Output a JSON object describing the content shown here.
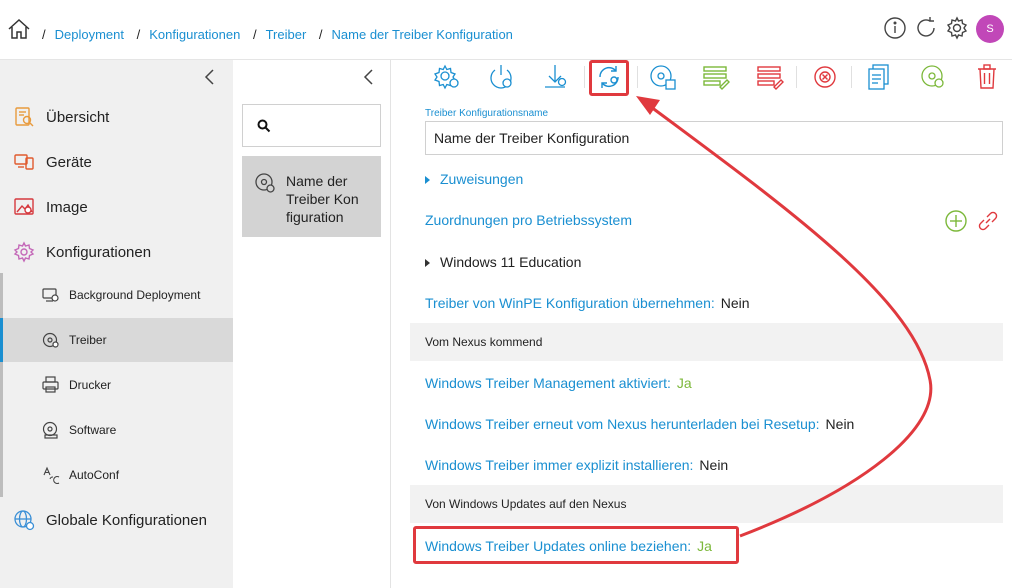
{
  "breadcrumb": {
    "sep": "/",
    "items": [
      "Deployment",
      "Konfigurationen",
      "Treiber",
      "Name der Treiber Konfiguration"
    ]
  },
  "user": {
    "initial": "S"
  },
  "sidebar": {
    "items": [
      {
        "label": "Übersicht",
        "icon": "overview-icon"
      },
      {
        "label": "Geräte",
        "icon": "devices-icon"
      },
      {
        "label": "Image",
        "icon": "image-icon"
      },
      {
        "label": "Konfigurationen",
        "icon": "configurations-icon"
      }
    ],
    "sub_items": [
      {
        "label": "Background Deployment",
        "icon": "background-deployment-icon"
      },
      {
        "label": "Treiber",
        "icon": "driver-icon",
        "active": true
      },
      {
        "label": "Drucker",
        "icon": "printer-icon"
      },
      {
        "label": "Software",
        "icon": "software-icon"
      },
      {
        "label": "AutoConf",
        "icon": "autoconf-icon"
      }
    ],
    "bottom_item": {
      "label": "Globale Konfigurationen",
      "icon": "globe-icon"
    }
  },
  "list": {
    "search_value": "",
    "card_lines": [
      "Name der",
      "Treiber Kon",
      "figuration"
    ]
  },
  "form": {
    "name_label": "Treiber Konfigurationsname",
    "name_value": "Name der Treiber Konfiguration",
    "zuweisungen": "Zuweisungen",
    "zuordnungen": "Zuordnungen pro Betriebssystem",
    "os_item": "Windows 11 Education",
    "winpe_key": "Treiber von WinPE Konfiguration übernehmen:",
    "winpe_val": "Nein",
    "section_nexus": "Vom Nexus kommend",
    "mgmt_key": "Windows Treiber Management aktiviert:",
    "mgmt_val": "Ja",
    "redownload_key": "Windows Treiber erneut vom Nexus herunterladen bei Resetup:",
    "redownload_val": "Nein",
    "explicit_key": "Windows Treiber immer explizit installieren:",
    "explicit_val": "Nein",
    "section_updates": "Von Windows Updates auf den Nexus",
    "online_key": "Windows Treiber Updates online beziehen:",
    "online_val": "Ja"
  },
  "colors": {
    "accent": "#1a8fd1",
    "green": "#7cb83a",
    "red": "#e0393e",
    "avatar": "#c147b8"
  }
}
